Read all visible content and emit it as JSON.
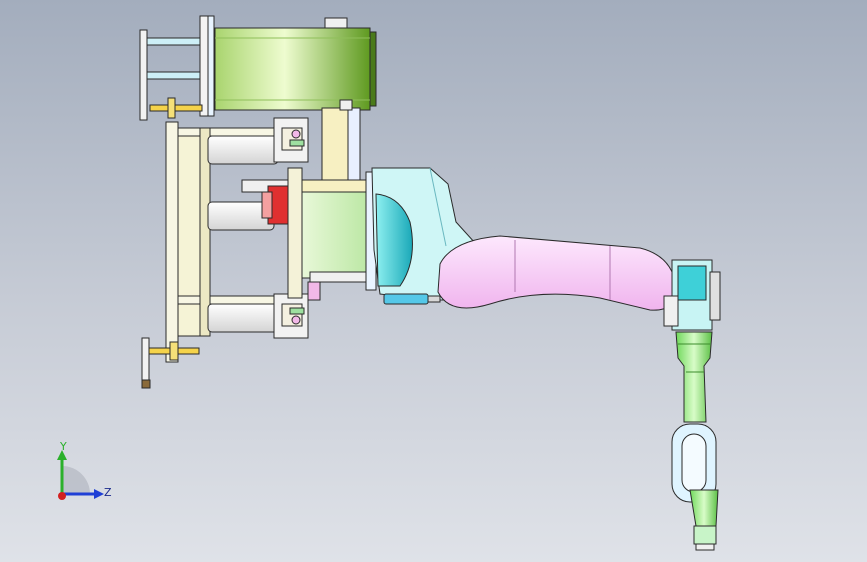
{
  "view": {
    "type": "cad-assembly-side-view",
    "background_top": "#a3adbd",
    "background_bottom": "#dfe2e8"
  },
  "colors": {
    "drum": "#c9ee9a",
    "drum_dark": "#6a9a2a",
    "column": "#f6f0c4",
    "frame": "#f4f2dc",
    "hub": "#d4f0c0",
    "upper_arm": "#f5c6f2",
    "shoulder": "#c8f4f4",
    "wrist": "#a8f08c",
    "teal": "#3ed0d8",
    "red_part": "#e03030",
    "outline": "#2a2a2a"
  },
  "triad": {
    "y_label": "Y",
    "z_label": "Z",
    "y_color": "#2bb02b",
    "z_color": "#1f3fd6",
    "x_color": "#d22020"
  }
}
